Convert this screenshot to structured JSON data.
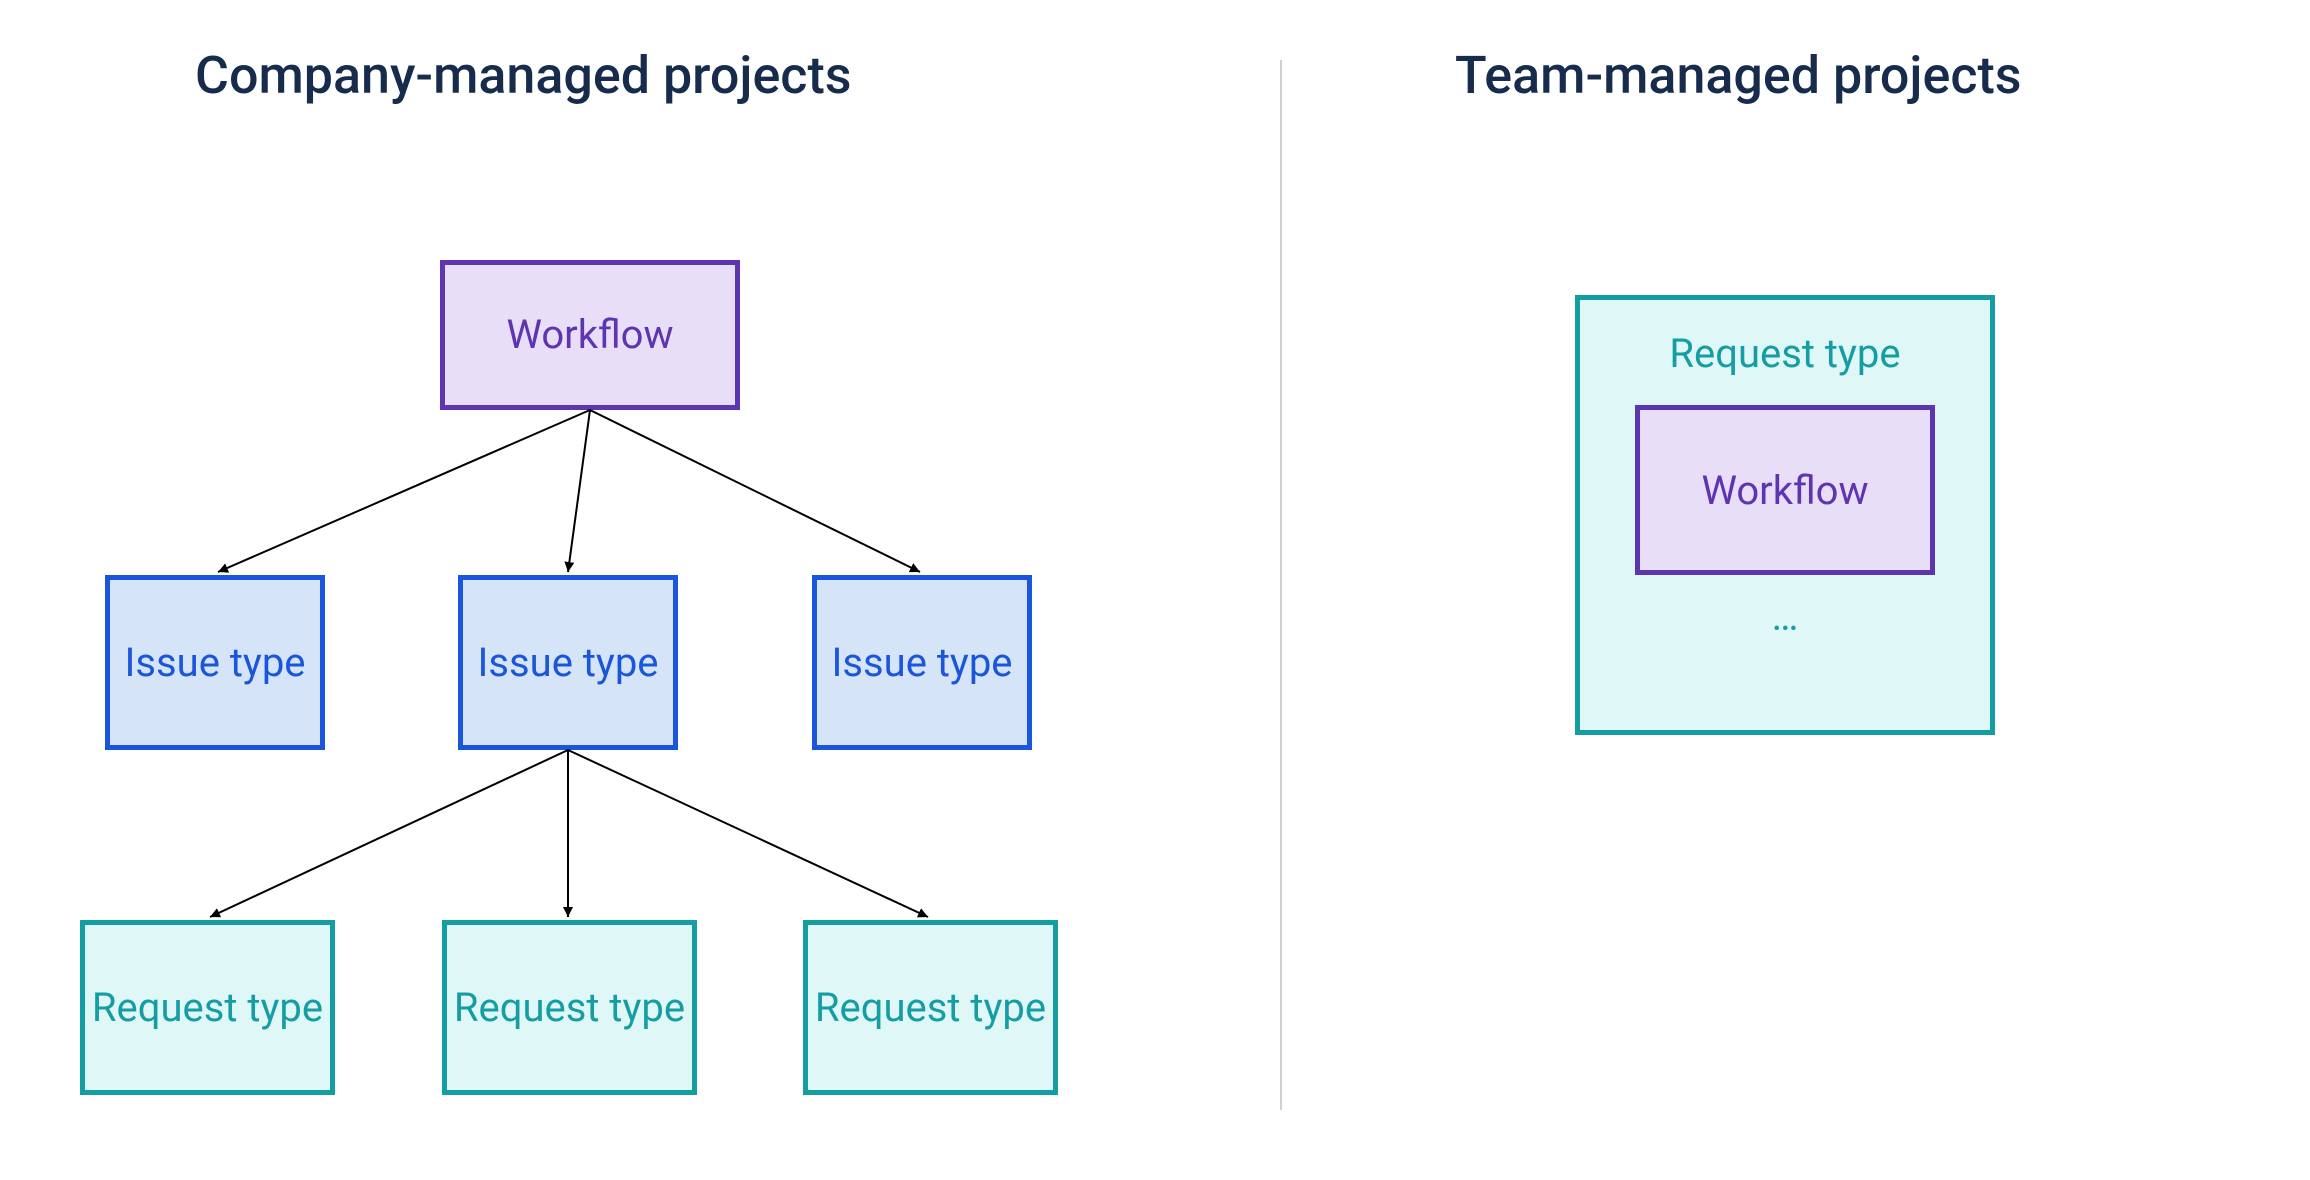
{
  "left": {
    "title": "Company-managed projects",
    "workflow_label": "Workflow",
    "issue_labels": [
      "Issue type",
      "Issue type",
      "Issue type"
    ],
    "request_labels": [
      "Request type",
      "Request type",
      "Request type"
    ]
  },
  "right": {
    "title": "Team-managed projects",
    "request_type_label": "Request type",
    "workflow_label": "Workflow",
    "ellipsis": "…"
  },
  "colors": {
    "workflow_border": "#5E35B1",
    "workflow_fill": "#E8DEF8",
    "issue_border": "#1A56DB",
    "issue_fill": "#D6E4F8",
    "request_border": "#149EA3",
    "request_fill": "#E0F7F7",
    "text_dark": "#172B4D"
  }
}
